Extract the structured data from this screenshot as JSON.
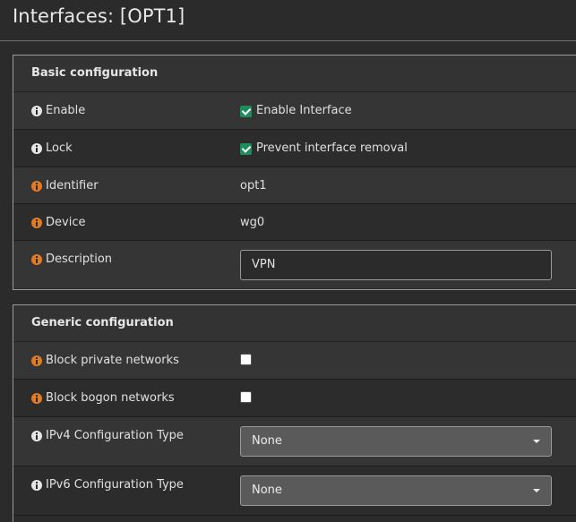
{
  "page": {
    "title": "Interfaces: [OPT1]"
  },
  "basic": {
    "header": "Basic configuration",
    "rows": [
      {
        "label": "Enable",
        "checkbox_label": "Enable Interface",
        "checked": true
      },
      {
        "label": "Lock",
        "checkbox_label": "Prevent interface removal",
        "checked": true
      },
      {
        "label": "Identifier",
        "value": "opt1"
      },
      {
        "label": "Device",
        "value": "wg0"
      },
      {
        "label": "Description",
        "value": "VPN"
      }
    ]
  },
  "generic": {
    "header": "Generic configuration",
    "rows": [
      {
        "label": "Block private networks",
        "checked": false
      },
      {
        "label": "Block bogon networks",
        "checked": false
      },
      {
        "label": "IPv4 Configuration Type",
        "selected": "None"
      },
      {
        "label": "IPv6 Configuration Type",
        "selected": "None"
      }
    ]
  },
  "colors": {
    "info_white": "#e6e6e6",
    "info_orange": "#e07b24",
    "checkbox_checked": "#1e8c5c",
    "select_bg": "#5a5a5a"
  }
}
